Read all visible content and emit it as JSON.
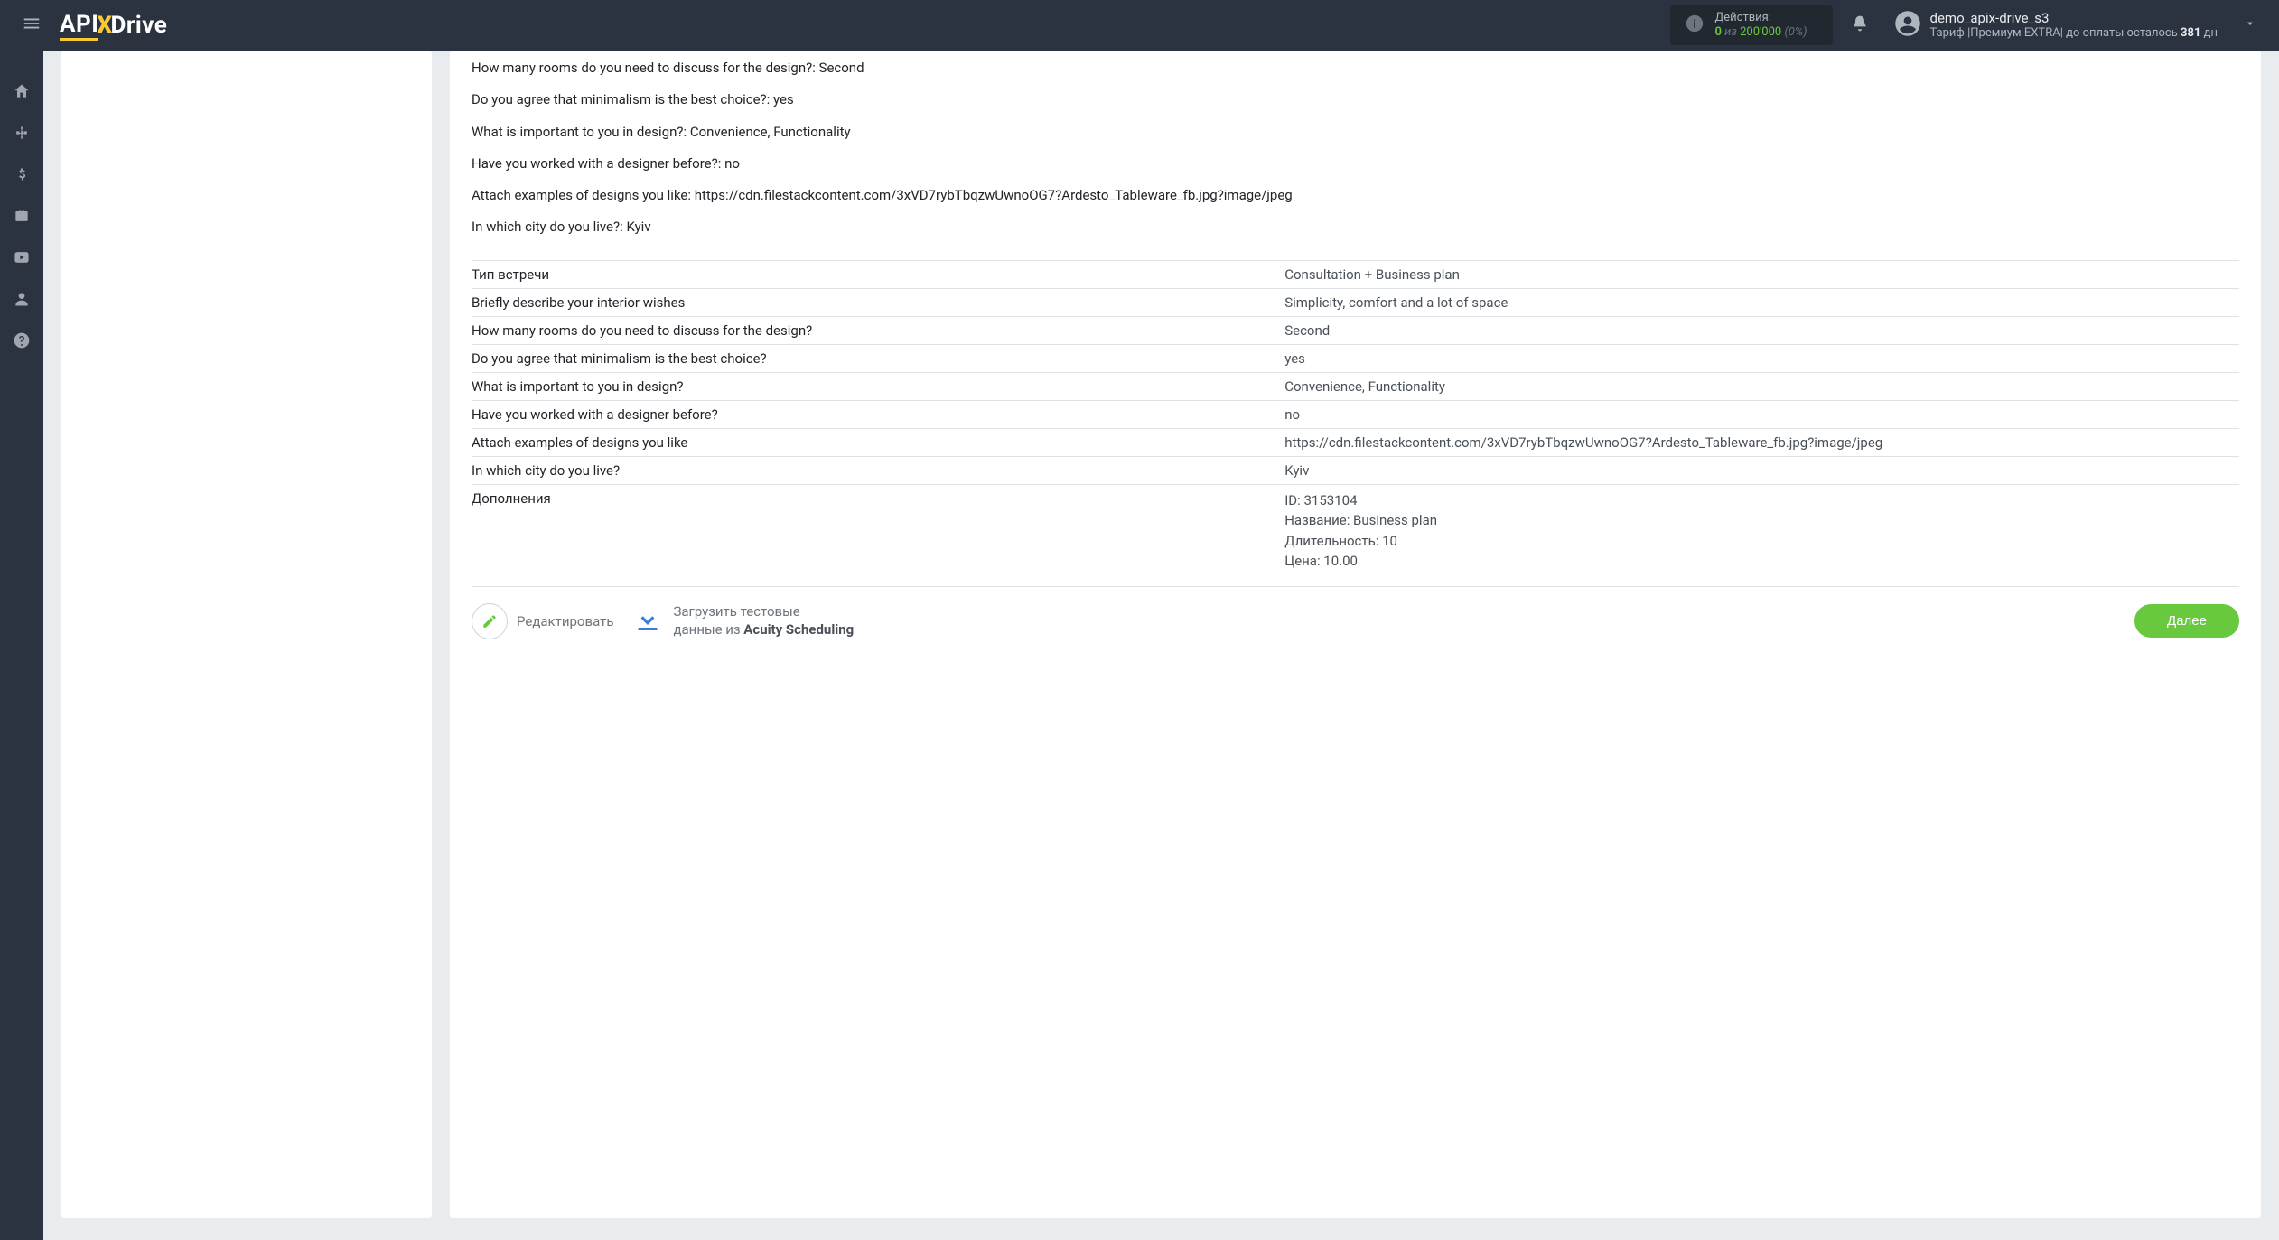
{
  "header": {
    "logo": {
      "part1": "API",
      "part2": "X",
      "part3": "Drive"
    },
    "actions": {
      "label": "Действия:",
      "current": "0",
      "iz": "из",
      "total": "200'000",
      "percent": "(0%)"
    },
    "user": {
      "name": "demo_apix-drive_s3",
      "tariff_label": "Тариф",
      "tariff_name": "Премиум EXTRA",
      "payment_prefix": "до оплаты осталось",
      "days": "381",
      "days_suffix": "дн"
    }
  },
  "description": {
    "line1": "How many rooms do you need to discuss for the design?: Second",
    "line2": "Do you agree that minimalism is the best choice?: yes",
    "line3": "What is important to you in design?: Convenience, Functionality",
    "line4": "Have you worked with a designer before?: no",
    "line5": "Attach examples of designs you like: https://cdn.filestackcontent.com/3xVD7rybTbqzwUwnoOG7?Ardesto_Tableware_fb.jpg?image/jpeg",
    "line6": "In which city do you live?: Kyiv"
  },
  "table": [
    {
      "label": "Тип встречи",
      "value": "Consultation + Business plan"
    },
    {
      "label": "Briefly describe your interior wishes",
      "value": "Simplicity, comfort and a lot of space"
    },
    {
      "label": "How many rooms do you need to discuss for the design?",
      "value": "Second"
    },
    {
      "label": "Do you agree that minimalism is the best choice?",
      "value": "yes"
    },
    {
      "label": "What is important to you in design?",
      "value": "Convenience, Functionality"
    },
    {
      "label": "Have you worked with a designer before?",
      "value": "no"
    },
    {
      "label": "Attach examples of designs you like",
      "value": "https://cdn.filestackcontent.com/3xVD7rybTbqzwUwnoOG7?Ardesto_Tableware_fb.jpg?image/jpeg"
    },
    {
      "label": "In which city do you live?",
      "value": "Kyiv"
    },
    {
      "label": "Дополнения",
      "value": "ID: 3153104\nНазвание: Business plan\nДлительность: 10\nЦена: 10.00"
    }
  ],
  "actions": {
    "edit": "Редактировать",
    "load_line1": "Загрузить тестовые",
    "load_line2_prefix": "данные из ",
    "load_line2_bold": "Acuity Scheduling",
    "next": "Далее"
  }
}
